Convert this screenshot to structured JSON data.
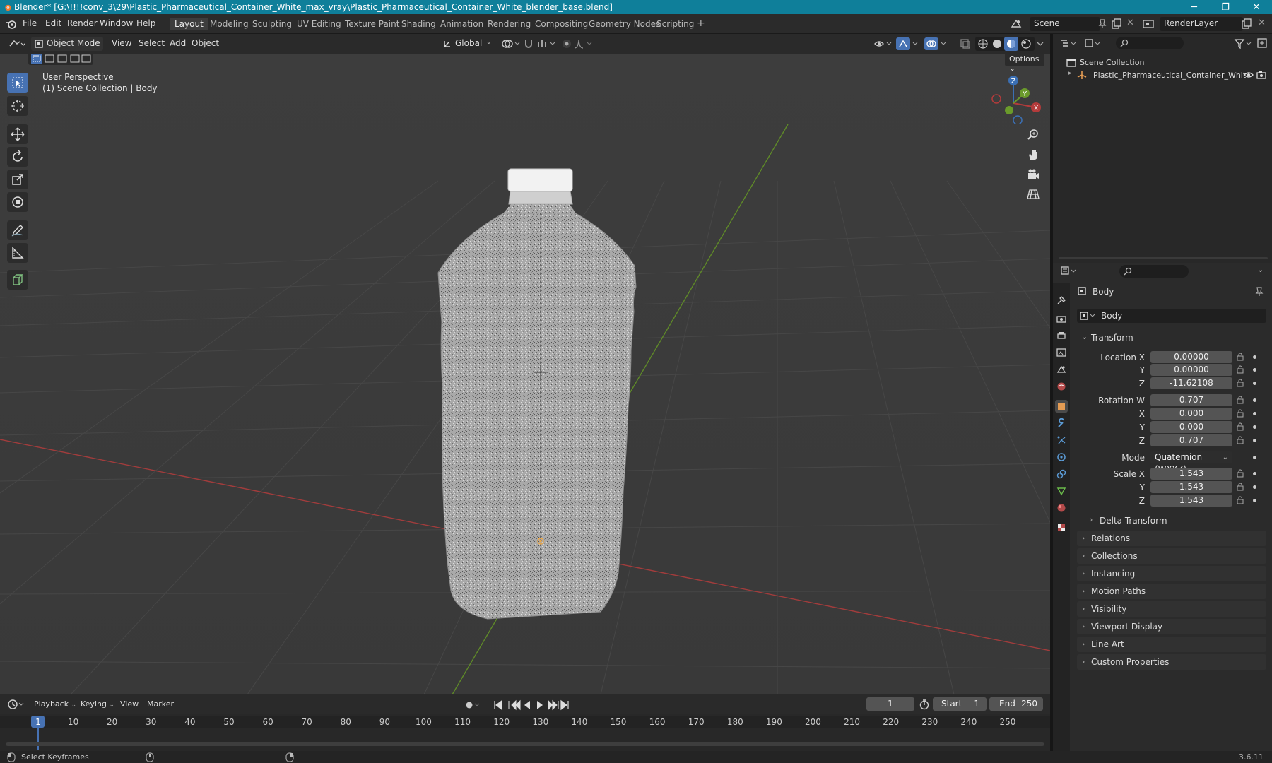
{
  "window": {
    "title": "Blender* [G:\\!!!!conv_3\\29\\Plastic_Pharmaceutical_Container_White_max_vray\\Plastic_Pharmaceutical_Container_White_blender_base.blend]",
    "minimize": "─",
    "maximize": "❐",
    "close": "✕"
  },
  "menu": [
    "File",
    "Edit",
    "Render",
    "Window",
    "Help"
  ],
  "workspaces": [
    "Layout",
    "Modeling",
    "Sculpting",
    "UV Editing",
    "Texture Paint",
    "Shading",
    "Animation",
    "Rendering",
    "Compositing",
    "Geometry Nodes",
    "Scripting",
    "+"
  ],
  "active_workspace": "Layout",
  "scene": {
    "name": "Scene",
    "render_layer": "RenderLayer"
  },
  "viewport_header": {
    "mode": "Object Mode",
    "menus": [
      "View",
      "Select",
      "Add",
      "Object"
    ],
    "orientation": "Global",
    "options": "Options"
  },
  "viewport": {
    "perspective": "User Perspective",
    "collection_info": "(1) Scene Collection | Body",
    "gizmo_axes": [
      "X",
      "Y",
      "Z"
    ]
  },
  "outliner": {
    "root": "Scene Collection",
    "items": [
      {
        "name": "Plastic_Pharmaceutical_Container_Whit"
      }
    ]
  },
  "properties": {
    "object_name": "Body",
    "data_name": "Body",
    "transform_title": "Transform",
    "location": {
      "label": "Location X",
      "x": "0.00000",
      "y": "0.00000",
      "z": "-11.62108"
    },
    "rotation": {
      "label": "Rotation W",
      "w": "0.707",
      "x": "0.000",
      "y": "0.000",
      "z": "0.707"
    },
    "mode": {
      "label": "Mode",
      "value": "Quaternion (WXYZ)"
    },
    "scale": {
      "label": "Scale X",
      "x": "1.543",
      "y": "1.543",
      "z": "1.543"
    },
    "axis_y": "Y",
    "axis_z": "Z",
    "axis_x": "X",
    "delta_transform": "Delta Transform",
    "panels": [
      "Relations",
      "Collections",
      "Instancing",
      "Motion Paths",
      "Visibility",
      "Viewport Display",
      "Line Art",
      "Custom Properties"
    ]
  },
  "timeline": {
    "menus": [
      "Playback",
      "Keying",
      "View",
      "Marker"
    ],
    "current_frame": "1",
    "start_label": "Start",
    "start": "1",
    "end_label": "End",
    "end": "250",
    "frame_marks": [
      "1",
      "10",
      "20",
      "30",
      "40",
      "50",
      "60",
      "70",
      "80",
      "90",
      "100",
      "110",
      "120",
      "130",
      "140",
      "150",
      "160",
      "170",
      "180",
      "190",
      "200",
      "210",
      "220",
      "230",
      "240",
      "250"
    ]
  },
  "statusbar": {
    "left": "Select Keyframes",
    "version": "3.6.11"
  },
  "colors": {
    "accent": "#4772b3",
    "title_bar": "#0f7f9a",
    "x_axis": "#b33b3b",
    "y_axis": "#6a9a2b",
    "z_axis": "#3b6fb3"
  }
}
